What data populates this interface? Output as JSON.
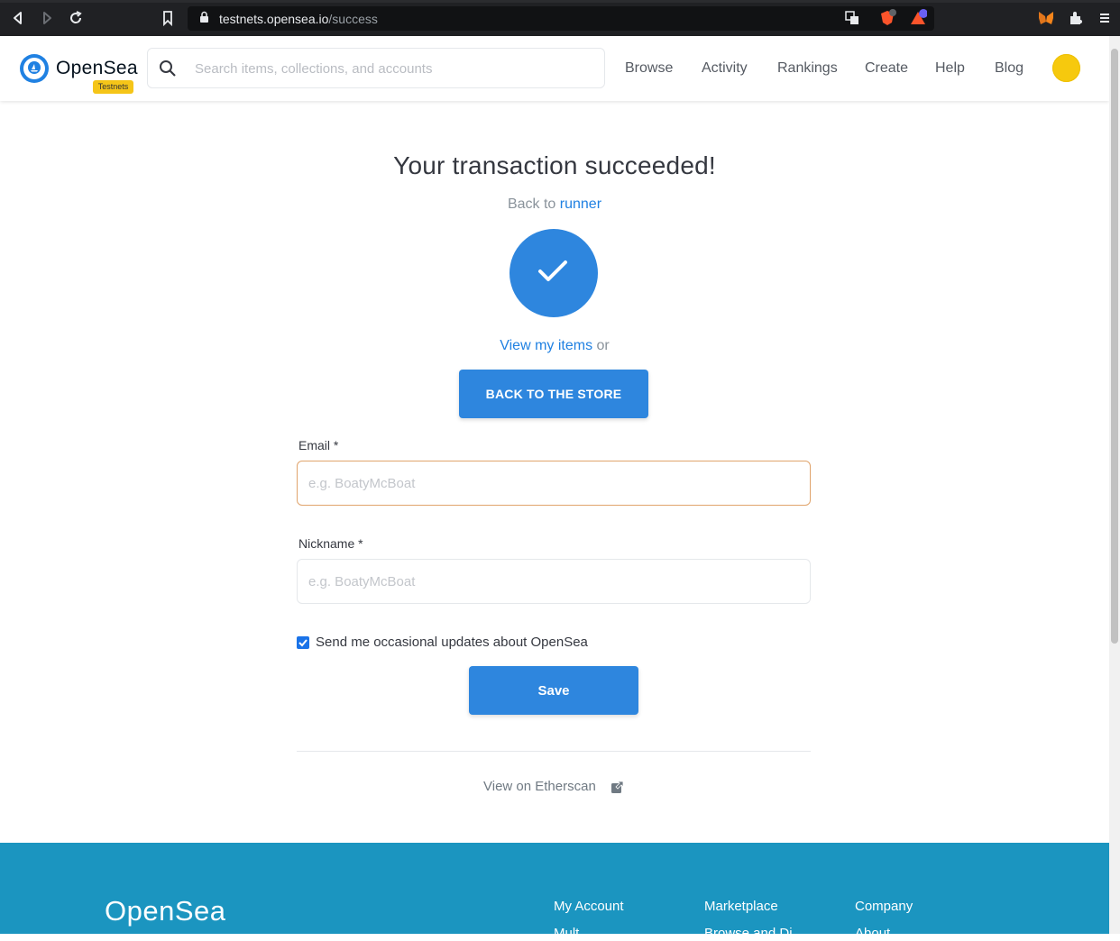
{
  "browser": {
    "url_host": "testnets.opensea.io",
    "url_path": "/success"
  },
  "header": {
    "logo_text": "OpenSea",
    "badge": "Testnets",
    "search_placeholder": "Search items, collections, and accounts",
    "nav": [
      "Browse",
      "Activity",
      "Rankings",
      "Create",
      "Help",
      "Blog"
    ]
  },
  "main": {
    "title": "Your transaction succeeded!",
    "back_to_prefix": "Back to",
    "back_to_link": "runner",
    "view_items_link": "View my items",
    "view_items_suffix": "or",
    "store_button": "BACK TO THE STORE",
    "email_label": "Email *",
    "email_placeholder": "e.g. BoatyMcBoat",
    "nickname_label": "Nickname *",
    "nickname_placeholder": "e.g. BoatyMcBoat",
    "updates_label": "Send me occasional updates about OpenSea",
    "updates_checked": true,
    "save_button": "Save",
    "etherscan_link": "View on Etherscan"
  },
  "footer": {
    "brand": "OpenSea",
    "columns": [
      "My Account",
      "Marketplace",
      "Company"
    ],
    "sub_items": [
      "Mult",
      "Browse and Di",
      "About"
    ]
  },
  "colors": {
    "accent": "#2081e2",
    "button": "#2e86de",
    "footer": "#1b95c0",
    "badge": "#f5c518"
  }
}
